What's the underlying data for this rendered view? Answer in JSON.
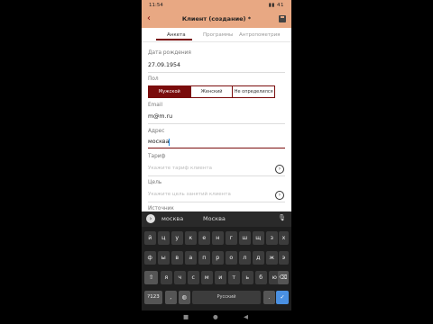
{
  "status": {
    "time": "11:54",
    "battery": "41"
  },
  "toolbar": {
    "title": "Клиент (создание) *"
  },
  "tabs": [
    {
      "label": "Анкета",
      "active": true
    },
    {
      "label": "Программы",
      "active": false
    },
    {
      "label": "Антропометрия",
      "active": false
    }
  ],
  "form": {
    "birth_label": "Дата рождения",
    "birth_value": "27.09.1954",
    "gender_label": "Пол",
    "gender_options": [
      "Мужской",
      "Женский",
      "Не определился"
    ],
    "gender_selected": "Мужской",
    "email_label": "Email",
    "email_value": "m@m.ru",
    "address_label": "Адрес",
    "address_value": "москва",
    "tariff_label": "Тариф",
    "tariff_placeholder": "Укажите тариф клиента",
    "goal_label": "Цель",
    "goal_placeholder": "Укажите цель занятий клиента",
    "source_label": "Источник"
  },
  "keyboard": {
    "suggestions": [
      "москва",
      "Москва"
    ],
    "row1": [
      "й",
      "ц",
      "у",
      "к",
      "е",
      "н",
      "г",
      "ш",
      "щ",
      "з",
      "х"
    ],
    "row2": [
      "ф",
      "ы",
      "в",
      "а",
      "п",
      "р",
      "о",
      "л",
      "д",
      "ж",
      "э"
    ],
    "row3": [
      "я",
      "ч",
      "с",
      "м",
      "и",
      "т",
      "ь",
      "б",
      "ю"
    ],
    "num_key": "?123",
    "comma_key": ",",
    "space_label": "Русский",
    "period_key": "."
  }
}
